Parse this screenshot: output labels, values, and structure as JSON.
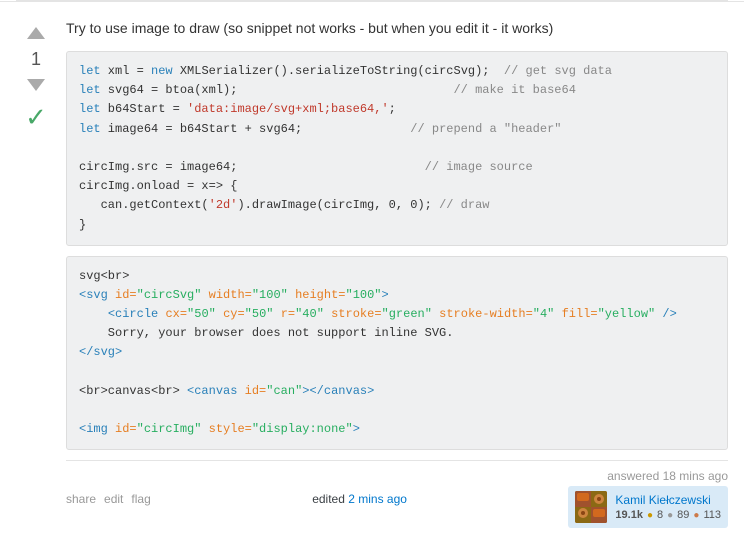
{
  "answer": {
    "title": "Try to use image to draw (so snippet not works - but when you edit it - it works)",
    "vote_count": "1",
    "code_block_1": {
      "lines": [
        {
          "text": "let xml = new XMLSerializer().serializeToString(circSvg);",
          "comment": "  // get svg data"
        },
        {
          "text": "let svg64 = btoa(xml);",
          "comment": "                              // make it base64"
        },
        {
          "text": "let b64Start = 'data:image/svg+xml;base64,';",
          "comment": ""
        },
        {
          "text": "let image64 = b64Start + svg64;",
          "comment": "               // prepend a \"header\""
        },
        {
          "text": "",
          "comment": ""
        },
        {
          "text": "circImg.src = image64;",
          "comment": "                          // image source"
        },
        {
          "text": "circImg.onload = x=> {",
          "comment": ""
        },
        {
          "text": "   can.getContext('2d').drawImage(circImg, 0, 0);",
          "comment": " // draw"
        },
        {
          "text": "}",
          "comment": ""
        }
      ]
    },
    "code_block_2": {
      "lines": [
        "svg<br>",
        "<svg id=\"circSvg\" width=\"100\" height=\"100\">",
        "    <circle cx=\"50\" cy=\"50\" r=\"40\" stroke=\"green\" stroke-width=\"4\" fill=\"yellow\" />",
        "    Sorry, your browser does not support inline SVG.",
        "</svg>",
        "",
        "<br>canvas<br> <canvas id=\"can\"></canvas>",
        "",
        "<img id=\"circImg\" style=\"display:none\">"
      ]
    },
    "actions": {
      "share": "share",
      "edit": "edit",
      "flag": "flag"
    },
    "edited": {
      "label": "edited",
      "time": "2 mins ago"
    },
    "answered": {
      "label": "answered 18 mins ago"
    },
    "user": {
      "name": "Kamil Kiełczewski",
      "rep": "19.1k",
      "gold": "8",
      "silver": "89",
      "bronze": "113"
    }
  }
}
